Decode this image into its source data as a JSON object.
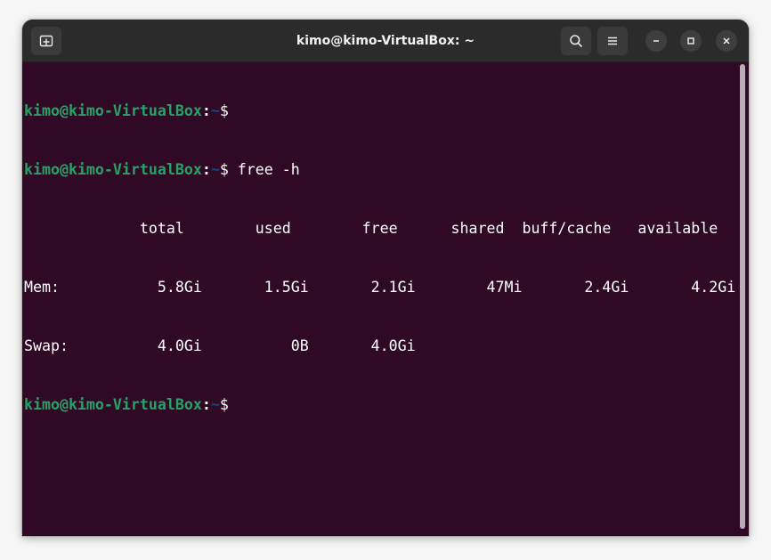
{
  "window": {
    "title": "kimo@kimo-VirtualBox: ~"
  },
  "toolbar": {
    "new_tab_icon": "new-tab-icon",
    "search_icon": "search-icon",
    "menu_icon": "hamburger-menu-icon"
  },
  "window_controls": {
    "minimize_icon": "minimize-icon",
    "maximize_icon": "maximize-icon",
    "close_icon": "close-icon"
  },
  "terminal": {
    "prompt_user": "kimo@kimo-VirtualBox",
    "prompt_sep": ":",
    "prompt_path": "~",
    "prompt_symbol": "$",
    "command": " free -h",
    "output": {
      "header": "             total        used        free      shared  buff/cache   available",
      "mem": "Mem:           5.8Gi       1.5Gi       2.1Gi        47Mi       2.4Gi       4.2Gi",
      "swap": "Swap:          4.0Gi          0B       4.0Gi"
    }
  },
  "colors": {
    "terminal_bg": "#300a24",
    "prompt_user": "#26a269",
    "prompt_path": "#12488b",
    "titlebar_bg": "#2b2b2b"
  }
}
